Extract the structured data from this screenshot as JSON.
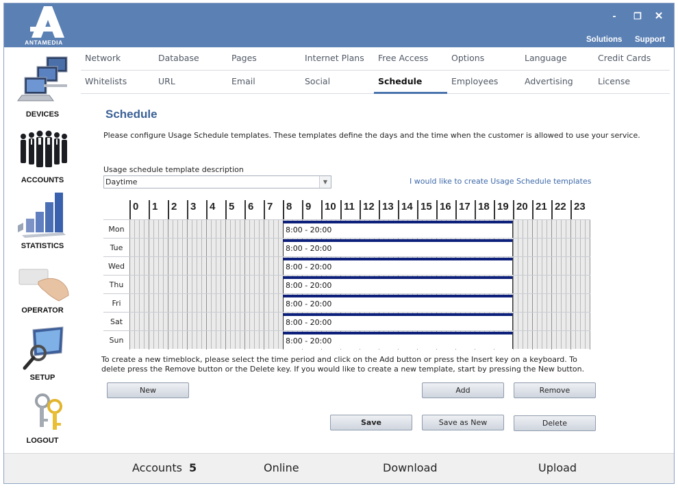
{
  "app": {
    "brand": "ANTAMEDIA",
    "window_controls": {
      "minimize": "-",
      "restore": "❐",
      "close": "✕"
    },
    "top_links": [
      "Solutions",
      "Support"
    ]
  },
  "sidebar": {
    "items": [
      {
        "label": "DEVICES",
        "icon": "devices-icon"
      },
      {
        "label": "ACCOUNTS",
        "icon": "accounts-icon"
      },
      {
        "label": "STATISTICS",
        "icon": "statistics-icon"
      },
      {
        "label": "OPERATOR",
        "icon": "operator-icon"
      },
      {
        "label": "SETUP",
        "icon": "setup-icon"
      },
      {
        "label": "LOGOUT",
        "icon": "logout-icon"
      }
    ]
  },
  "tabs": {
    "row1": [
      "Network",
      "Database",
      "Pages",
      "Internet Plans",
      "Free Access",
      "Options",
      "Language",
      "Credit Cards"
    ],
    "row2": [
      "Whitelists",
      "URL",
      "Email",
      "Social",
      "Schedule",
      "Employees",
      "Advertising",
      "License"
    ],
    "active": "Schedule"
  },
  "main": {
    "title": "Schedule",
    "description": "Please configure Usage Schedule templates. These templates define the days and the time when the customer is allowed to use your service.",
    "template_label": "Usage schedule template description",
    "template_value": "Daytime",
    "create_link": "I would like to create Usage Schedule templates",
    "help_text": "To create a new timeblock, please select the time period and click on the Add button or press the Insert key on a keyboard. To delete press the Remove button or the Delete key. If you would like to create a new template, start by pressing the New button."
  },
  "schedule": {
    "hours": [
      "0",
      "1",
      "2",
      "3",
      "4",
      "5",
      "6",
      "7",
      "8",
      "9",
      "10",
      "11",
      "12",
      "13",
      "14",
      "15",
      "16",
      "17",
      "18",
      "19",
      "20",
      "21",
      "22",
      "23"
    ],
    "days": [
      {
        "name": "Mon",
        "block": {
          "label": "8:00 - 20:00",
          "start": 8,
          "end": 20
        }
      },
      {
        "name": "Tue",
        "block": {
          "label": "8:00 - 20:00",
          "start": 8,
          "end": 20
        }
      },
      {
        "name": "Wed",
        "block": {
          "label": "8:00 - 20:00",
          "start": 8,
          "end": 20
        }
      },
      {
        "name": "Thu",
        "block": {
          "label": "8:00 - 20:00",
          "start": 8,
          "end": 20
        }
      },
      {
        "name": "Fri",
        "block": {
          "label": "8:00 - 20:00",
          "start": 8,
          "end": 20
        }
      },
      {
        "name": "Sat",
        "block": {
          "label": "8:00 - 20:00",
          "start": 8,
          "end": 20
        }
      },
      {
        "name": "Sun",
        "block": {
          "label": "8:00 - 20:00",
          "start": 8,
          "end": 20
        }
      }
    ]
  },
  "buttons": {
    "new": "New",
    "add": "Add",
    "remove": "Remove",
    "save": "Save",
    "save_as_new": "Save as New",
    "delete": "Delete"
  },
  "footer": {
    "accounts_label": "Accounts",
    "accounts_value": "5",
    "online_label": "Online",
    "download_label": "Download",
    "upload_label": "Upload"
  },
  "colors": {
    "header_bg": "#5b80b4",
    "accent": "#3a6096",
    "timeblock_border": "#0c1f7a"
  }
}
